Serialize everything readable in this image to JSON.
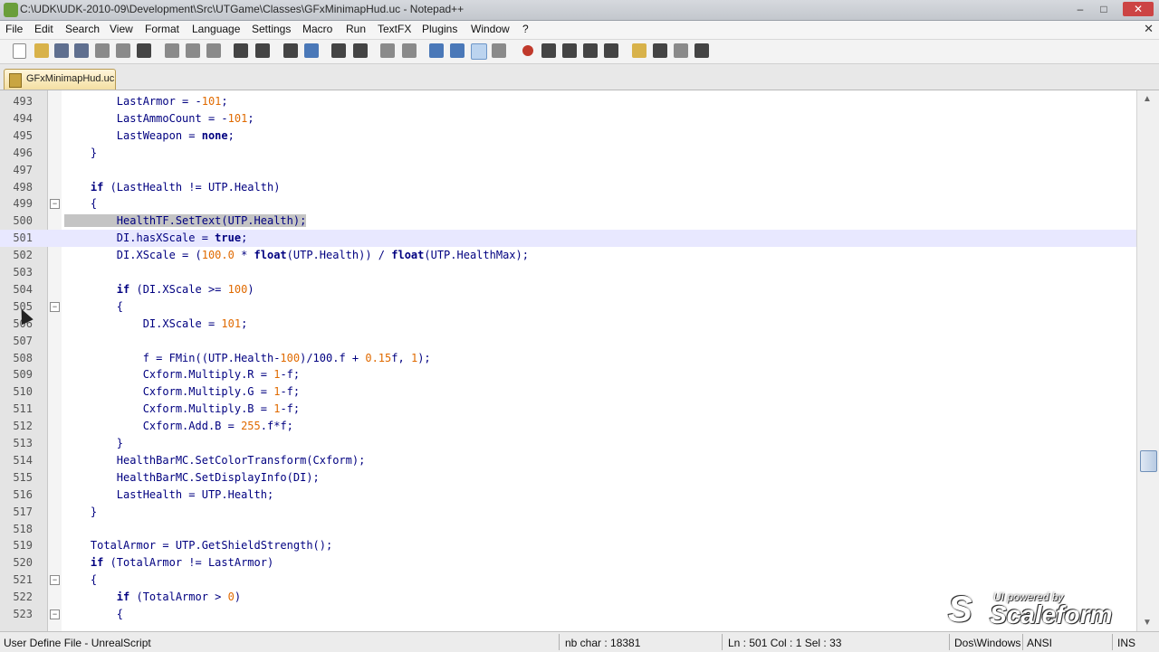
{
  "window": {
    "title": "C:\\UDK\\UDK-2010-09\\Development\\Src\\UTGame\\Classes\\GFxMinimapHud.uc - Notepad++",
    "minimize": "‒",
    "maximize": "□",
    "close": "✕"
  },
  "menu": {
    "items": [
      "File",
      "Edit",
      "Search",
      "View",
      "Format",
      "Language",
      "Settings",
      "Macro",
      "Run",
      "TextFX",
      "Plugins",
      "Window",
      "?"
    ],
    "close_glyph": "✕"
  },
  "tabs": [
    {
      "label": "GFxMinimapHud.uc"
    }
  ],
  "editor": {
    "current_line": "501",
    "lines": [
      {
        "n": "493",
        "indent": "        ",
        "parts": [
          [
            "t",
            "LastArmor = -"
          ],
          [
            "n",
            "101"
          ],
          [
            "t",
            ";"
          ]
        ]
      },
      {
        "n": "494",
        "indent": "        ",
        "parts": [
          [
            "t",
            "LastAmmoCount = -"
          ],
          [
            "n",
            "101"
          ],
          [
            "t",
            ";"
          ]
        ]
      },
      {
        "n": "495",
        "indent": "        ",
        "parts": [
          [
            "t",
            "LastWeapon = "
          ],
          [
            "k",
            "none"
          ],
          [
            "t",
            ";"
          ]
        ]
      },
      {
        "n": "496",
        "indent": "    ",
        "parts": [
          [
            "t",
            "}"
          ]
        ]
      },
      {
        "n": "497",
        "indent": "",
        "parts": []
      },
      {
        "n": "498",
        "indent": "    ",
        "parts": [
          [
            "k",
            "if"
          ],
          [
            "t",
            " (LastHealth != UTP.Health)"
          ]
        ]
      },
      {
        "n": "499",
        "indent": "    ",
        "parts": [
          [
            "t",
            "{"
          ]
        ],
        "fold": "−"
      },
      {
        "n": "500",
        "indent": "",
        "parts": [
          [
            "s",
            "        HealthTF.SetText(UTP.Health);"
          ]
        ]
      },
      {
        "n": "501",
        "indent": "        ",
        "parts": [
          [
            "t",
            "DI.hasXScale = "
          ],
          [
            "k",
            "true"
          ],
          [
            "t",
            ";"
          ]
        ]
      },
      {
        "n": "502",
        "indent": "        ",
        "parts": [
          [
            "t",
            "DI.XScale = ("
          ],
          [
            "n",
            "100.0"
          ],
          [
            "t",
            " * "
          ],
          [
            "k",
            "float"
          ],
          [
            "t",
            "(UTP.Health)) / "
          ],
          [
            "k",
            "float"
          ],
          [
            "t",
            "(UTP.HealthMax);"
          ]
        ]
      },
      {
        "n": "503",
        "indent": "",
        "parts": []
      },
      {
        "n": "504",
        "indent": "        ",
        "parts": [
          [
            "k",
            "if"
          ],
          [
            "t",
            " (DI.XScale >= "
          ],
          [
            "n",
            "100"
          ],
          [
            "t",
            ")"
          ]
        ]
      },
      {
        "n": "505",
        "indent": "        ",
        "parts": [
          [
            "t",
            "{"
          ]
        ],
        "fold": "−"
      },
      {
        "n": "506",
        "indent": "            ",
        "parts": [
          [
            "t",
            "DI.XScale = "
          ],
          [
            "n",
            "101"
          ],
          [
            "t",
            ";"
          ]
        ]
      },
      {
        "n": "507",
        "indent": "",
        "parts": []
      },
      {
        "n": "508",
        "indent": "            ",
        "parts": [
          [
            "t",
            "f = FMin((UTP.Health-"
          ],
          [
            "n",
            "100"
          ],
          [
            "t",
            ")/100.f + "
          ],
          [
            "n",
            "0.15"
          ],
          [
            "t",
            "f, "
          ],
          [
            "n",
            "1"
          ],
          [
            "t",
            ");"
          ]
        ]
      },
      {
        "n": "509",
        "indent": "            ",
        "parts": [
          [
            "t",
            "Cxform.Multiply.R = "
          ],
          [
            "n",
            "1"
          ],
          [
            "t",
            "-f;"
          ]
        ]
      },
      {
        "n": "510",
        "indent": "            ",
        "parts": [
          [
            "t",
            "Cxform.Multiply.G = "
          ],
          [
            "n",
            "1"
          ],
          [
            "t",
            "-f;"
          ]
        ]
      },
      {
        "n": "511",
        "indent": "            ",
        "parts": [
          [
            "t",
            "Cxform.Multiply.B = "
          ],
          [
            "n",
            "1"
          ],
          [
            "t",
            "-f;"
          ]
        ]
      },
      {
        "n": "512",
        "indent": "            ",
        "parts": [
          [
            "t",
            "Cxform.Add.B = "
          ],
          [
            "n",
            "255"
          ],
          [
            "t",
            ".f*f;"
          ]
        ]
      },
      {
        "n": "513",
        "indent": "        ",
        "parts": [
          [
            "t",
            "}"
          ]
        ]
      },
      {
        "n": "514",
        "indent": "        ",
        "parts": [
          [
            "t",
            "HealthBarMC.SetColorTransform(Cxform);"
          ]
        ]
      },
      {
        "n": "515",
        "indent": "        ",
        "parts": [
          [
            "t",
            "HealthBarMC.SetDisplayInfo(DI);"
          ]
        ]
      },
      {
        "n": "516",
        "indent": "        ",
        "parts": [
          [
            "t",
            "LastHealth = UTP.Health;"
          ]
        ]
      },
      {
        "n": "517",
        "indent": "    ",
        "parts": [
          [
            "t",
            "}"
          ]
        ]
      },
      {
        "n": "518",
        "indent": "",
        "parts": []
      },
      {
        "n": "519",
        "indent": "    ",
        "parts": [
          [
            "t",
            "TotalArmor = UTP.GetShieldStrength();"
          ]
        ]
      },
      {
        "n": "520",
        "indent": "    ",
        "parts": [
          [
            "k",
            "if"
          ],
          [
            "t",
            " (TotalArmor != LastArmor)"
          ]
        ]
      },
      {
        "n": "521",
        "indent": "    ",
        "parts": [
          [
            "t",
            "{"
          ]
        ],
        "fold": "−"
      },
      {
        "n": "522",
        "indent": "        ",
        "parts": [
          [
            "k",
            "if"
          ],
          [
            "t",
            " (TotalArmor > "
          ],
          [
            "n",
            "0"
          ],
          [
            "t",
            ")"
          ]
        ]
      },
      {
        "n": "523",
        "indent": "        ",
        "parts": [
          [
            "t",
            "{"
          ]
        ],
        "fold": "−"
      }
    ]
  },
  "status": {
    "file_type": "User Define File - UnrealScript",
    "nb_char": "nb char : 18381",
    "position": "Ln : 501    Col : 1    Sel : 33",
    "eol": "Dos\\Windows",
    "encoding": "ANSI",
    "mode": "INS"
  },
  "watermark": {
    "top": "UI powered by",
    "brand": "Scaleform",
    "mark": "S"
  },
  "colors": {
    "code_text": "#000080",
    "number": "#e06a00",
    "current_line": "#e8e8ff",
    "selection": "#c4c4c4"
  }
}
